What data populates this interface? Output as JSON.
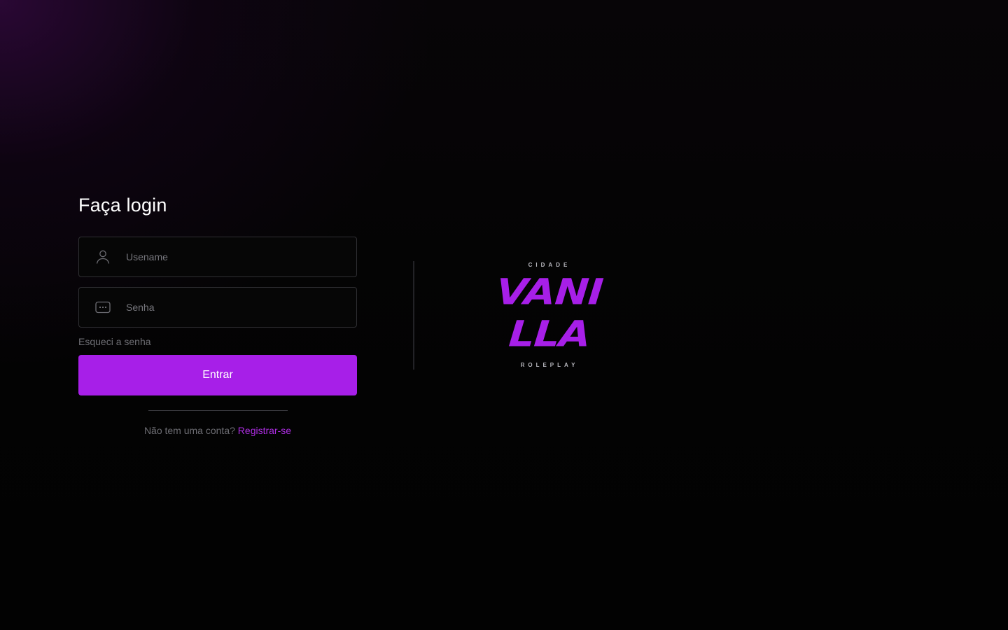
{
  "login": {
    "title": "Faça login",
    "username_placeholder": "Usename",
    "password_placeholder": "Senha",
    "forgot_password": "Esqueci a senha",
    "submit_label": "Entrar",
    "no_account_text": "Não tem uma conta?",
    "register_link": "Registrar-se"
  },
  "logo": {
    "top_text": "CIDADE",
    "line1": "VANI",
    "line2": "LLA",
    "bottom_text": "ROLEPLAY"
  },
  "icons": {
    "username": "user-icon",
    "password": "password-dots-icon"
  },
  "colors": {
    "accent": "#a71fe8",
    "background": "#030303",
    "muted_text": "#6e6e74"
  }
}
